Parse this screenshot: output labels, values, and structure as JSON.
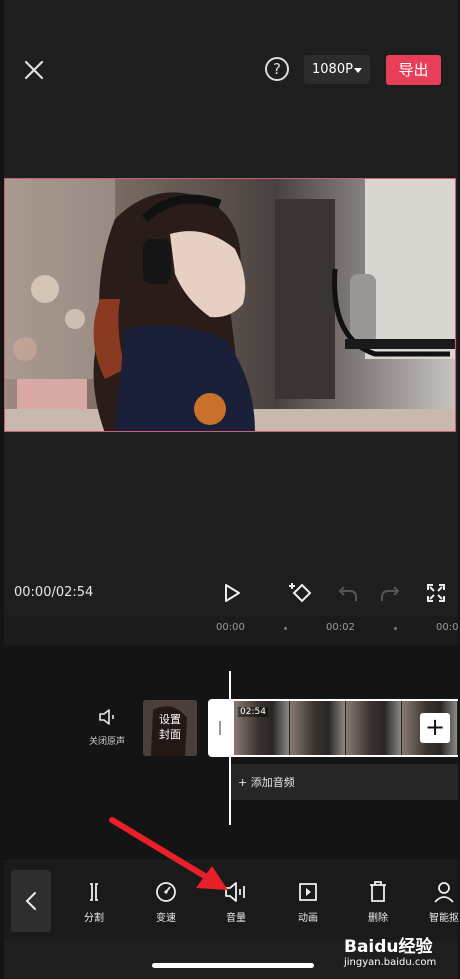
{
  "header": {
    "close_icon": "close-icon",
    "help_label": "?",
    "resolution": "1080P",
    "export_label": "导出"
  },
  "player": {
    "time": "00:00/02:54"
  },
  "ruler": {
    "ticks": [
      "00:00",
      "00:02",
      "00:0"
    ]
  },
  "timeline": {
    "mute_label": "关闭原声",
    "cover_label_line1": "设置",
    "cover_label_line2": "封面",
    "clip_duration": "02:54",
    "add_clip_label": "+",
    "add_audio_label": "+ 添加音频"
  },
  "toolbar": {
    "items": [
      {
        "label": "分割",
        "icon": "split-icon"
      },
      {
        "label": "变速",
        "icon": "speed-icon"
      },
      {
        "label": "音量",
        "icon": "volume-icon"
      },
      {
        "label": "动画",
        "icon": "animation-icon"
      },
      {
        "label": "删除",
        "icon": "delete-icon"
      },
      {
        "label": "智能抠",
        "icon": "smart-cutout-icon"
      }
    ]
  },
  "watermark": {
    "logo": "Baidu经验",
    "url": "jingyan.baidu.com"
  },
  "colors": {
    "accent": "#e83e5a",
    "arrow": "#e8202a"
  }
}
